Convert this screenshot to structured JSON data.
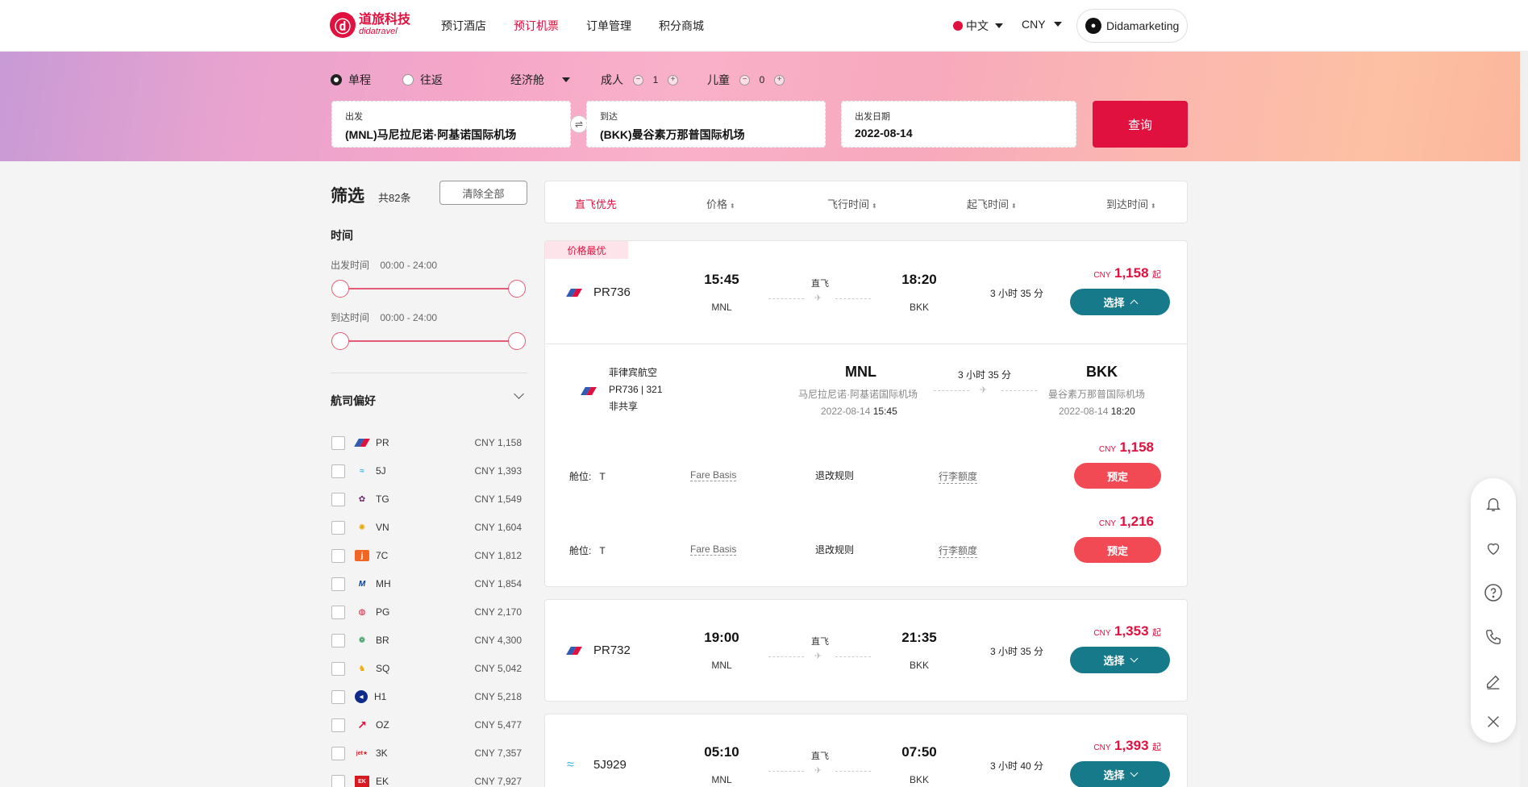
{
  "header": {
    "logo_cn": "道旅科技",
    "logo_en": "didatravel",
    "nav": [
      "预订酒店",
      "预订机票",
      "订单管理",
      "积分商城"
    ],
    "lang": "中文",
    "currency": "CNY",
    "user": "Didamarketing"
  },
  "search": {
    "trip_one_way": "单程",
    "trip_round": "往返",
    "cabin": "经济舱",
    "adult_label": "成人",
    "adult_count": "1",
    "child_label": "儿童",
    "child_count": "0",
    "from_label": "出发",
    "from_value": "(MNL)马尼拉尼诺·阿基诺国际机场",
    "to_label": "到达",
    "to_value": "(BKK)曼谷素万那普国际机场",
    "date_label": "出发日期",
    "date_value": "2022-08-14",
    "search_btn": "查询"
  },
  "filter": {
    "title": "筛选",
    "count": "共82条",
    "clear_all": "清除全部",
    "time_title": "时间",
    "dep_time_label": "出发时间",
    "dep_time_range": "00:00 - 24:00",
    "arr_time_label": "到达时间",
    "arr_time_range": "00:00 - 24:00",
    "airline_pref": "航司偏好",
    "airlines": [
      {
        "code": "PR",
        "price": "CNY 1,158"
      },
      {
        "code": "5J",
        "price": "CNY 1,393"
      },
      {
        "code": "TG",
        "price": "CNY 1,549"
      },
      {
        "code": "VN",
        "price": "CNY 1,604"
      },
      {
        "code": "7C",
        "price": "CNY 1,812"
      },
      {
        "code": "MH",
        "price": "CNY 1,854"
      },
      {
        "code": "PG",
        "price": "CNY 2,170"
      },
      {
        "code": "BR",
        "price": "CNY 4,300"
      },
      {
        "code": "SQ",
        "price": "CNY 5,042"
      },
      {
        "code": "H1",
        "price": "CNY 5,218"
      },
      {
        "code": "OZ",
        "price": "CNY 5,477"
      },
      {
        "code": "3K",
        "price": "CNY 7,357"
      },
      {
        "code": "EK",
        "price": "CNY 7,927"
      }
    ]
  },
  "sort": {
    "direct_first": "直飞优先",
    "price": "价格",
    "flight_time": "飞行时间",
    "dep_time": "起飞时间",
    "arr_time": "到达时间",
    "arrow": "⬍"
  },
  "flights": [
    {
      "tag": "价格最优",
      "flight_no": "PR736",
      "dep_time": "15:45",
      "dep_airport": "MNL",
      "direct": "直飞",
      "arr_time": "18:20",
      "arr_airport": "BKK",
      "duration": "3 小时 35 分",
      "currency": "CNY",
      "price": "1,158",
      "price_suffix": "起",
      "select": "选择"
    },
    {
      "flight_no": "PR732",
      "dep_time": "19:00",
      "dep_airport": "MNL",
      "direct": "直飞",
      "arr_time": "21:35",
      "arr_airport": "BKK",
      "duration": "3 小时 35 分",
      "currency": "CNY",
      "price": "1,353",
      "price_suffix": "起",
      "select": "选择"
    },
    {
      "flight_no": "5J929",
      "dep_time": "05:10",
      "dep_airport": "MNL",
      "direct": "直飞",
      "arr_time": "07:50",
      "arr_airport": "BKK",
      "duration": "3 小时 40 分",
      "currency": "CNY",
      "price": "1,393",
      "price_suffix": "起",
      "select": "选择"
    }
  ],
  "detail": {
    "airline_name": "菲律宾航空",
    "flight_info": "PR736 | 321",
    "share": "非共享",
    "dep_code": "MNL",
    "dep_airport": "马尼拉尼诺·阿基诺国际机场",
    "dep_date": "2022-08-14",
    "dep_time": "15:45",
    "duration": "3 小时 35 分",
    "arr_code": "BKK",
    "arr_airport": "曼谷素万那普国际机场",
    "arr_date": "2022-08-14",
    "arr_time": "18:20",
    "fares": [
      {
        "cabin_label": "舱位:",
        "cabin": "T",
        "fare_basis": "Fare Basis",
        "rules": "退改规则",
        "baggage": "行李额度",
        "currency": "CNY",
        "price": "1,158",
        "book": "预定"
      },
      {
        "cabin_label": "舱位:",
        "cabin": "T",
        "fare_basis": "Fare Basis",
        "rules": "退改规则",
        "baggage": "行李额度",
        "currency": "CNY",
        "price": "1,216",
        "book": "预定"
      }
    ]
  },
  "colors": {
    "brand": "#e0103f",
    "select_btn": "#177a8a",
    "book_btn": "#f24a55"
  },
  "floatbar_icons": [
    "bell-icon",
    "heart-icon",
    "help-icon",
    "phone-icon",
    "edit-icon",
    "close-icon"
  ]
}
